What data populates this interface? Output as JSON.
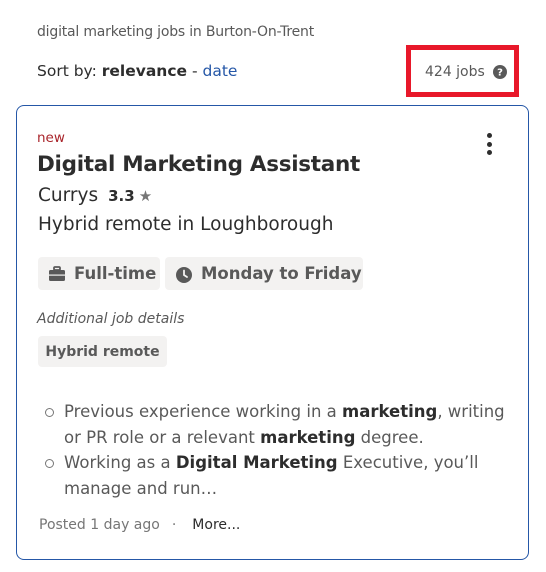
{
  "search": {
    "subtitle": "digital marketing jobs in Burton-On-Trent"
  },
  "sort": {
    "prefix": "Sort by:",
    "active": "relevance",
    "separator": "-",
    "alternate": "date"
  },
  "results": {
    "count_label": "424 jobs",
    "help_icon": "question-circle-icon",
    "highlight_color": "#e8182a"
  },
  "job": {
    "badge": "new",
    "title": "Digital Marketing Assistant",
    "company": "Currys",
    "rating": "3.3",
    "rating_icon": "star-icon",
    "location": "Hybrid remote in Loughborough",
    "attributes": [
      {
        "icon": "briefcase-icon",
        "label": "Full-time"
      },
      {
        "icon": "clock-icon",
        "label": "Monday to Friday"
      }
    ],
    "additional_label": "Additional job details",
    "additional_tags": [
      "Hybrid remote"
    ],
    "snippet": [
      {
        "parts": [
          "Previous experience working in a ",
          "marketing",
          ", writing or PR role or a relevant ",
          "marketing",
          " degree."
        ]
      },
      {
        "parts": [
          "Working as a ",
          "Digital Marketing",
          " Executive, you’ll manage and run…"
        ]
      }
    ],
    "posted": "Posted 1 day ago",
    "footer_separator": "·",
    "more_label": "More..."
  },
  "colors": {
    "card_border": "#2557a7",
    "link": "#2557a7",
    "new_badge": "#a9252b",
    "chip_bg": "#f3f2f1"
  }
}
